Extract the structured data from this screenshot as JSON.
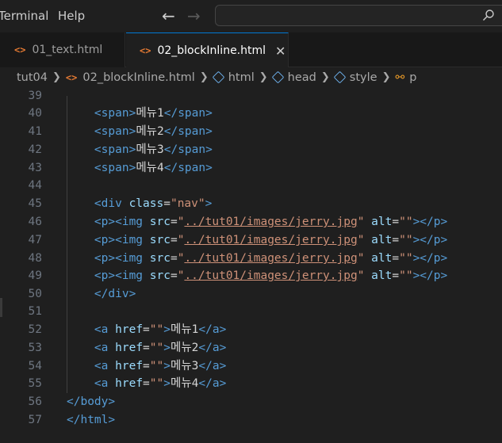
{
  "menubar": {
    "terminal": "Terminal",
    "help": "Help"
  },
  "tabs": [
    {
      "label": "01_text.html",
      "active": false
    },
    {
      "label": "02_blockInline.html",
      "active": true
    }
  ],
  "breadcrumb": [
    "tut04",
    "02_blockInline.html",
    "html",
    "head",
    "style",
    "p"
  ],
  "code": {
    "l39": "39",
    "l40": "40",
    "l41": "41",
    "l42": "42",
    "l43": "43",
    "l44": "44",
    "l45": "45",
    "l46": "46",
    "l47": "47",
    "l48": "48",
    "l49": "49",
    "l50": "50",
    "l51": "51",
    "l52": "52",
    "l53": "53",
    "l54": "54",
    "l55": "55",
    "l56": "56",
    "l57": "57",
    "span_open": "<span>",
    "span_close": "</span>",
    "menu1": "메뉴1",
    "menu2": "메뉴2",
    "menu3": "메뉴3",
    "menu4": "메뉴4",
    "div_open_start": "<div",
    "class_attr": "class",
    "eq": "=",
    "nav_value": "\"nav\"",
    "gt": ">",
    "p_img": "<p><img",
    "src_attr": "src",
    "quote": "\"",
    "img_path": "../tut01/images/jerry.jpg",
    "alt_attr": "alt",
    "empty_str": "\"\"",
    "p_close": "></p>",
    "div_close": "</div>",
    "a_open": "<a",
    "href_attr": "href",
    "a_close": "</a>",
    "body_close": "</body>",
    "html_close": "</html>"
  },
  "colors": {
    "accent": "#0078d4",
    "tag": "#569cd6",
    "attr": "#9cdcfe",
    "string": "#ce9178",
    "html_icon": "#e37933"
  }
}
